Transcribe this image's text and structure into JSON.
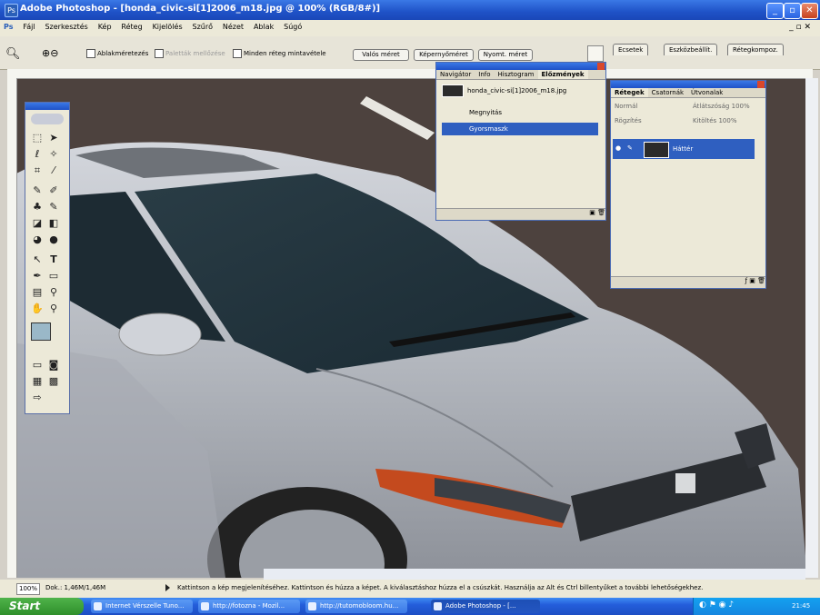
{
  "window": {
    "title": "Adobe Photoshop - [honda_civic-si[1]2006_m18.jpg @ 100% (RGB/8#)]",
    "app_icon": "Ps",
    "controls": [
      "minimize",
      "maximize",
      "close"
    ]
  },
  "menu": {
    "items": [
      "Fájl",
      "Szerkesztés",
      "Kép",
      "Réteg",
      "Kijelölés",
      "Szűrő",
      "Nézet",
      "Ablak",
      "Súgó"
    ]
  },
  "options_bar": {
    "all_layers_label": "Minden réteg mintavétele",
    "fill_label": "Átlátszóság",
    "actual_pixels": "Valós méret",
    "fit_screen": "Képernyőméret",
    "print_size": "Nyomt. méret",
    "well_tabs": [
      "Ecsetek",
      "Eszközbeállít.",
      "Rétegkompoz."
    ]
  },
  "toolbox": {
    "tools": [
      "marquee-icon",
      "move-icon",
      "lasso-icon",
      "magic-wand-icon",
      "crop-icon",
      "slice-icon",
      "heal-icon",
      "brush-icon",
      "stamp-icon",
      "history-brush-icon",
      "eraser-icon",
      "gradient-icon",
      "blur-icon",
      "dodge-icon",
      "path-select-icon",
      "type-icon",
      "pen-icon",
      "shape-icon",
      "notes-icon",
      "eyedropper-icon",
      "hand-icon",
      "zoom-icon"
    ]
  },
  "history_panel": {
    "tabs": [
      "Navigátor",
      "Info",
      "Hisztogram",
      "Előzmények"
    ],
    "snapshot": "honda_civic-si[1]2006_m18.jpg",
    "rows": [
      "Megnyitás",
      "Gyorsmaszk"
    ],
    "selected_index": 1
  },
  "layers_panel": {
    "tabs": [
      "Rétegek",
      "Csatornák",
      "Útvonalak"
    ],
    "blend_mode": "Normál",
    "opacity_label": "Átlátszóság",
    "opacity": "100%",
    "lock_label": "Rögzítés",
    "fill_label": "Kitöltés",
    "fill": "100%",
    "layer_name": "Háttér"
  },
  "status": {
    "zoom": "100%",
    "doc": "Dok.: 1,46M/1,46M",
    "hint": "Kattintson a kép megjelenítéséhez. Kattintson és húzza a képet. A kiválasztáshoz húzza el a csúszkát. Használja az Alt és Ctrl billentyűket a további lehetőségekhez."
  },
  "taskbar": {
    "start": "Start",
    "tasks": [
      "Internet Vérszelle Tuno...",
      "http://fotozna - Mozil...",
      "http://tutomobloom.hu...",
      "Adobe Photoshop - [..."
    ],
    "active_index": 3,
    "clock": "21:45"
  },
  "colors": {
    "titlebar": "#1f52c7",
    "selection": "#2f5fc0",
    "car": "#b8bcc4",
    "road": "#4a3f3b"
  }
}
